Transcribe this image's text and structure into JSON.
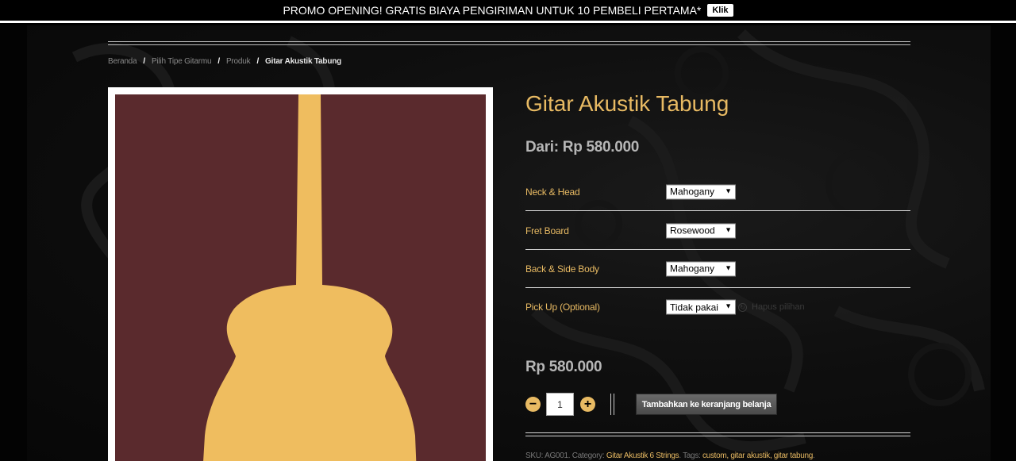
{
  "promo": {
    "text": "PROMO OPENING! GRATIS BIAYA PENGIRIMAN UNTUK 10 PEMBELI PERTAMA*",
    "button": "Klik"
  },
  "breadcrumb": {
    "items": [
      "Beranda",
      "Pilih Tipe Gitarmu",
      "Produk"
    ],
    "separator": "/",
    "current": "Gitar Akustik Tabung"
  },
  "product": {
    "title": "Gitar Akustik Tabung",
    "price_from": "Dari: Rp 580.000",
    "variations": [
      {
        "label": "Neck & Head",
        "value": "Mahogany"
      },
      {
        "label": "Fret Board",
        "value": "Rosewood"
      },
      {
        "label": "Back & Side Body",
        "value": "Mahogany"
      },
      {
        "label": "Pick Up (Optional)",
        "value": "Tidak pakai"
      }
    ],
    "clear_label": "Hapus pilihan",
    "price": "Rp 580.000",
    "quantity": "1",
    "add_to_cart": "Tambahkan ke keranjang belanja",
    "meta": {
      "sku_label": "SKU:",
      "sku": "AG001.",
      "category_label": "Category:",
      "category": "Gitar Akustik 6 Strings",
      "tags_label": "Tags:",
      "tags": "custom, gitar akustik, gitar tabung"
    }
  },
  "icons": {
    "minus": "minus-icon",
    "plus": "plus-icon",
    "clear": "clear-icon",
    "dropdown": "chevron-down-icon"
  },
  "colors": {
    "accent": "#e8ba63",
    "image_bg": "#5a2a2d",
    "guitar": "#efbd5f"
  }
}
